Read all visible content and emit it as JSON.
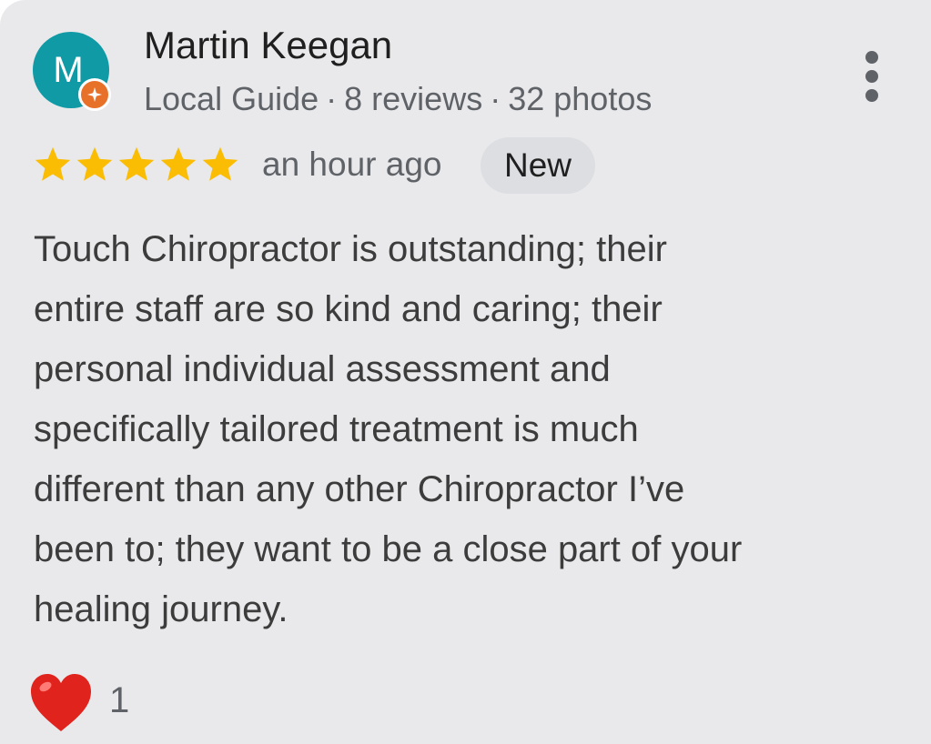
{
  "reviewer": {
    "initial": "M",
    "name": "Martin Keegan",
    "level": "Local Guide",
    "reviews": "8 reviews",
    "photos": "32 photos",
    "avatar_color": "#0f9aa6",
    "badge_color": "#e8712a"
  },
  "rating": {
    "stars": 5,
    "max": 5,
    "color": "#fbbc04"
  },
  "time": "an hour ago",
  "badge": "New",
  "review_lines": [
    "Touch Chiropractor is outstanding; their",
    "entire staff are so kind and caring; their",
    "personal individual assessment and",
    "specifically tailored treatment is much",
    "different than any other Chiropractor I’ve",
    "been to; they want to be a close part of your",
    "healing journey."
  ],
  "reaction": {
    "icon": "heart-icon",
    "count": "1",
    "color": "#e0231c"
  },
  "icons": {
    "more": "more-vert-icon",
    "guide": "local-guide-star-icon",
    "star": "star-icon"
  },
  "separator": "·"
}
